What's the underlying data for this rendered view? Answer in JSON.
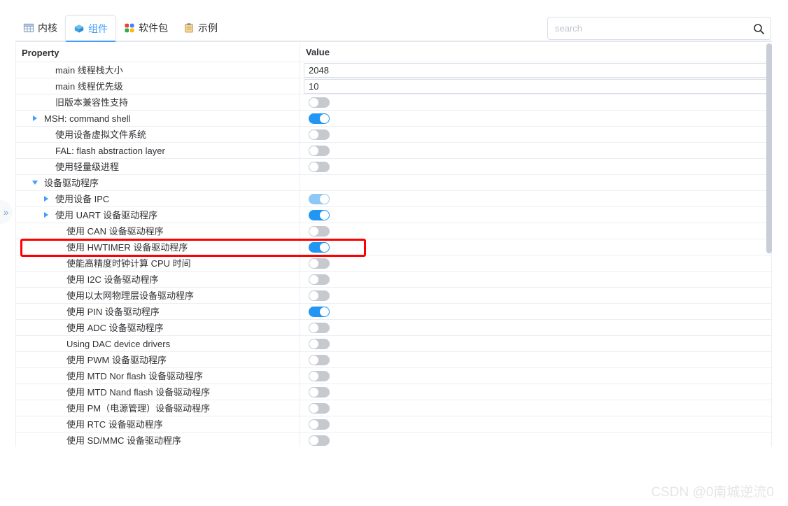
{
  "tabs": [
    {
      "label": "内核",
      "icon": "kernel-grid-icon",
      "active": false
    },
    {
      "label": "组件",
      "icon": "component-cube-icon",
      "active": true
    },
    {
      "label": "软件包",
      "icon": "packages-quad-icon",
      "active": false
    },
    {
      "label": "示例",
      "icon": "examples-clipboard-icon",
      "active": false
    }
  ],
  "search": {
    "value": "",
    "placeholder": "search",
    "button_icon": "search-icon"
  },
  "table": {
    "columns": [
      "Property",
      "Value"
    ],
    "rows": [
      {
        "label": "main 线程栈大小",
        "indent": 1,
        "arrow": "none",
        "value_type": "input",
        "value": "2048"
      },
      {
        "label": "main 线程优先级",
        "indent": 1,
        "arrow": "none",
        "value_type": "input",
        "value": "10"
      },
      {
        "label": "旧版本兼容性支持",
        "indent": 1,
        "arrow": "none",
        "value_type": "switch",
        "value": "off"
      },
      {
        "label": "MSH: command shell",
        "indent": 0,
        "arrow": "right",
        "value_type": "switch",
        "value": "on"
      },
      {
        "label": "使用设备虚拟文件系统",
        "indent": 1,
        "arrow": "none",
        "value_type": "switch",
        "value": "off"
      },
      {
        "label": "FAL: flash abstraction layer",
        "indent": 1,
        "arrow": "none",
        "value_type": "switch",
        "value": "off"
      },
      {
        "label": "使用轻量级进程",
        "indent": 1,
        "arrow": "none",
        "value_type": "switch",
        "value": "off"
      },
      {
        "label": "设备驱动程序",
        "indent": 0,
        "arrow": "down",
        "value_type": "none",
        "value": ""
      },
      {
        "label": "使用设备 IPC",
        "indent": 1,
        "arrow": "right",
        "value_type": "switch",
        "value": "on-dim"
      },
      {
        "label": "使用 UART 设备驱动程序",
        "indent": 1,
        "arrow": "right",
        "value_type": "switch",
        "value": "on"
      },
      {
        "label": "使用 CAN 设备驱动程序",
        "indent": 2,
        "arrow": "none",
        "value_type": "switch",
        "value": "off"
      },
      {
        "label": "使用 HWTIMER 设备驱动程序",
        "indent": 2,
        "arrow": "none",
        "value_type": "switch",
        "value": "on",
        "highlighted": true
      },
      {
        "label": "使能高精度时钟计算 CPU 时间",
        "indent": 2,
        "arrow": "none",
        "value_type": "switch",
        "value": "off"
      },
      {
        "label": "使用 I2C 设备驱动程序",
        "indent": 2,
        "arrow": "none",
        "value_type": "switch",
        "value": "off"
      },
      {
        "label": "使用以太网物理层设备驱动程序",
        "indent": 2,
        "arrow": "none",
        "value_type": "switch",
        "value": "off"
      },
      {
        "label": "使用 PIN 设备驱动程序",
        "indent": 2,
        "arrow": "none",
        "value_type": "switch",
        "value": "on"
      },
      {
        "label": "使用 ADC 设备驱动程序",
        "indent": 2,
        "arrow": "none",
        "value_type": "switch",
        "value": "off"
      },
      {
        "label": "Using DAC device drivers",
        "indent": 2,
        "arrow": "none",
        "value_type": "switch",
        "value": "off"
      },
      {
        "label": "使用 PWM 设备驱动程序",
        "indent": 2,
        "arrow": "none",
        "value_type": "switch",
        "value": "off"
      },
      {
        "label": "使用 MTD Nor flash 设备驱动程序",
        "indent": 2,
        "arrow": "none",
        "value_type": "switch",
        "value": "off"
      },
      {
        "label": "使用 MTD Nand flash 设备驱动程序",
        "indent": 2,
        "arrow": "none",
        "value_type": "switch",
        "value": "off"
      },
      {
        "label": "使用 PM（电源管理）设备驱动程序",
        "indent": 2,
        "arrow": "none",
        "value_type": "switch",
        "value": "off"
      },
      {
        "label": "使用 RTC 设备驱动程序",
        "indent": 2,
        "arrow": "none",
        "value_type": "switch",
        "value": "off"
      },
      {
        "label": "使用 SD/MMC 设备驱动程序",
        "indent": 2,
        "arrow": "none",
        "value_type": "switch",
        "value": "off"
      }
    ]
  },
  "left_handle": {
    "icon": "chevron-double-right-icon",
    "glyph": "»"
  },
  "watermark": {
    "text": "CSDN @0南城逆流0"
  },
  "colors": {
    "accent": "#409eff",
    "switch_on": "#2196f3",
    "switch_on_dim": "#8fc7f5",
    "switch_off": "#c6c9ce",
    "highlight_box": "#ff0000",
    "border": "#ebeef5"
  }
}
